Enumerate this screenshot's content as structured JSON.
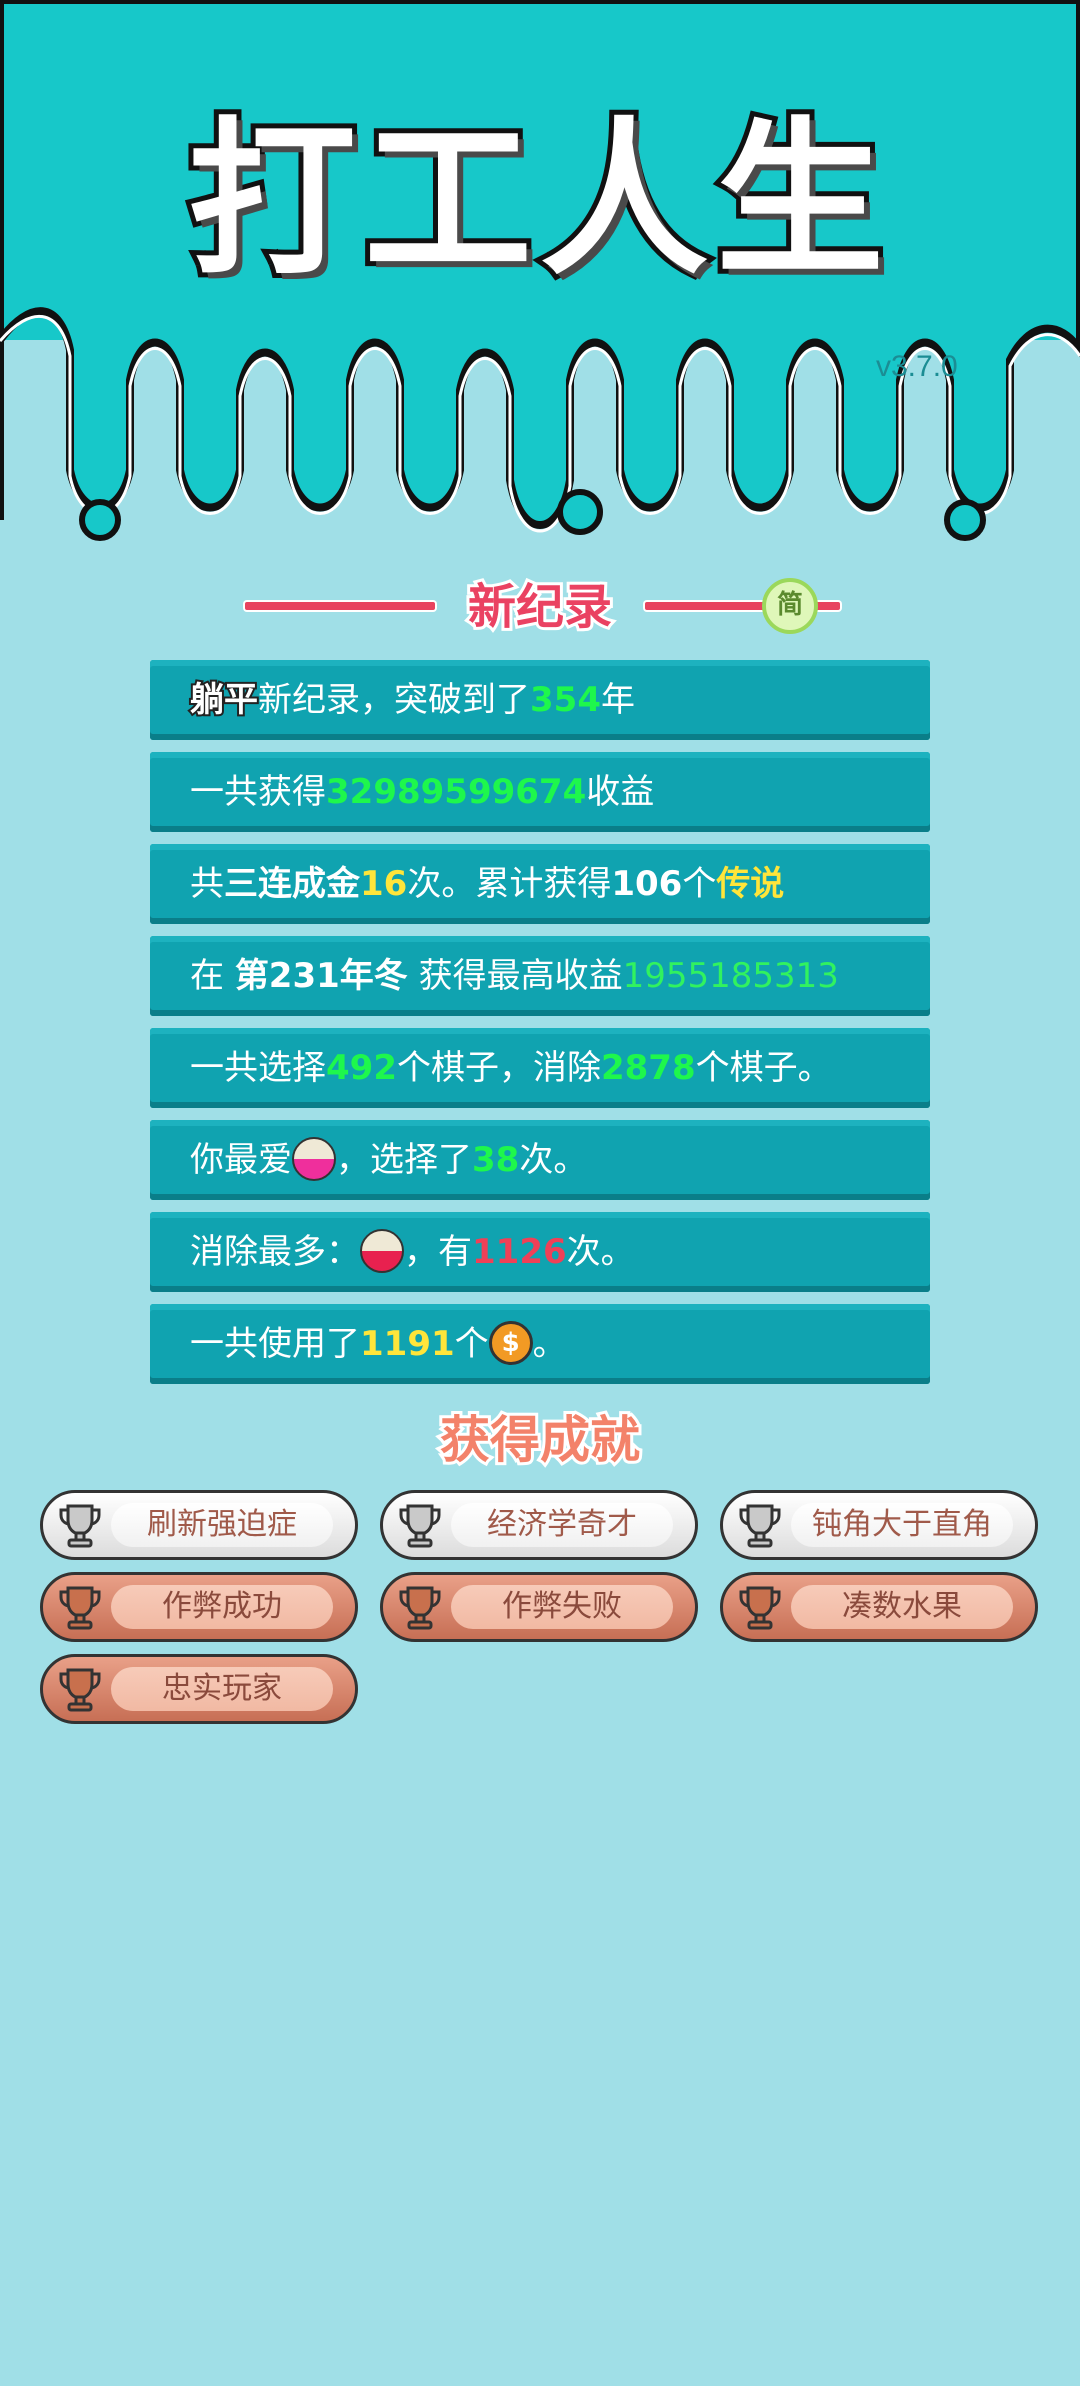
{
  "game": {
    "title": "打工人生",
    "version": "v3.7.0"
  },
  "record_section": {
    "title": "新纪录",
    "badge": "简",
    "rows": [
      {
        "parts": [
          {
            "t": "躺平",
            "s": "hl"
          },
          {
            "t": "新纪录，突破到了"
          },
          {
            "t": "354",
            "s": "g"
          },
          {
            "t": "年"
          }
        ]
      },
      {
        "parts": [
          {
            "t": "一共获得"
          },
          {
            "t": "32989599674",
            "s": "g"
          },
          {
            "t": "收益"
          }
        ]
      },
      {
        "parts": [
          {
            "t": "共"
          },
          {
            "t": "三连成金",
            "s": "b"
          },
          {
            "t": "16",
            "s": "y"
          },
          {
            "t": "次。累计获得"
          },
          {
            "t": "106",
            "s": "b"
          },
          {
            "t": "个"
          },
          {
            "t": "传说",
            "s": "y"
          }
        ]
      },
      {
        "parts": [
          {
            "t": "在 "
          },
          {
            "t": "第231年冬",
            "s": "b"
          },
          {
            "t": " 获得最高收益"
          },
          {
            "t": "1955185313",
            "s": "gl"
          }
        ]
      },
      {
        "parts": [
          {
            "t": "一共选择"
          },
          {
            "t": "492",
            "s": "g"
          },
          {
            "t": "个棋子，消除"
          },
          {
            "t": "2878",
            "s": "g"
          },
          {
            "t": "个棋子。"
          }
        ]
      },
      {
        "parts": [
          {
            "t": "你最爱"
          },
          {
            "icon": "bowl-pink"
          },
          {
            "t": "，选择了"
          },
          {
            "t": "38",
            "s": "g"
          },
          {
            "t": "次。"
          }
        ]
      },
      {
        "parts": [
          {
            "t": "消除最多："
          },
          {
            "icon": "bowl-red"
          },
          {
            "t": "，有"
          },
          {
            "t": "1126",
            "s": "r"
          },
          {
            "t": "次。"
          }
        ]
      },
      {
        "parts": [
          {
            "t": "一共使用了"
          },
          {
            "t": "1191",
            "s": "y"
          },
          {
            "t": "个"
          },
          {
            "icon": "coin"
          },
          {
            "t": "。"
          }
        ]
      }
    ]
  },
  "achievements": {
    "title": "获得成就",
    "items": [
      {
        "label": "刷新强迫症",
        "tier": "silver"
      },
      {
        "label": "经济学奇才",
        "tier": "silver"
      },
      {
        "label": "钝角大于直角",
        "tier": "silver"
      },
      {
        "label": "作弊成功",
        "tier": "bronze"
      },
      {
        "label": "作弊失败",
        "tier": "bronze"
      },
      {
        "label": "凑数水果",
        "tier": "bronze"
      },
      {
        "label": "忠实玩家",
        "tier": "bronze"
      }
    ]
  },
  "colors": {
    "teal_top": "#17c8c9",
    "background": "#a0dfe7",
    "row_bg": "#10a3b0",
    "accent_green": "#1ef74c",
    "accent_yellow": "#ffe53a",
    "accent_red": "#f04057"
  }
}
